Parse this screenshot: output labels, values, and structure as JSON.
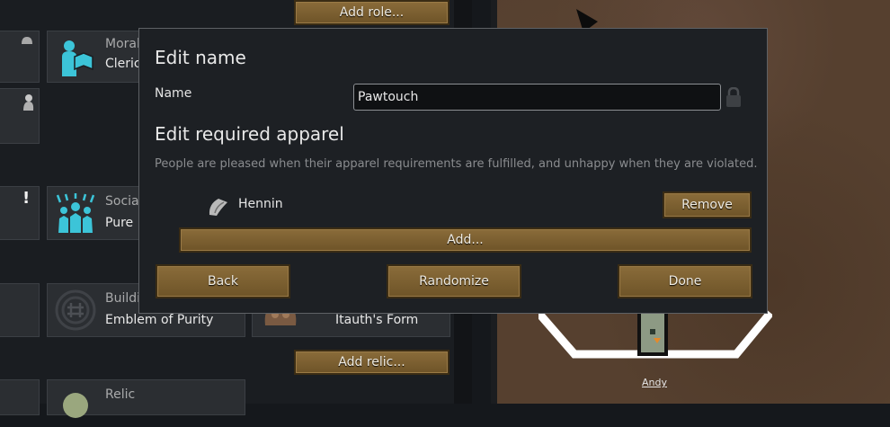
{
  "left_pane": {
    "add_role_label": "Add role...",
    "add_relic_label": "Add relic...",
    "cards": [
      {
        "category": "Moral",
        "value": "Cleric"
      },
      {
        "category": "Social",
        "value": "Pure"
      },
      {
        "category": "Building",
        "value": "Emblem of Purity"
      },
      {
        "category": "",
        "value": "Itauth's Form"
      },
      {
        "category": "Relic",
        "value": ""
      }
    ],
    "warning_glyph": "!"
  },
  "dialog": {
    "title": "Edit name",
    "name_label": "Name",
    "name_value": "Pawtouch",
    "apparel_title": "Edit required apparel",
    "apparel_desc": "People are pleased when their apparel requirements are fulfilled, and unhappy when they are violated.",
    "apparel_items": [
      {
        "name": "Hennin",
        "remove_label": "Remove"
      }
    ],
    "add_label": "Add...",
    "back_label": "Back",
    "randomize_label": "Randomize",
    "done_label": "Done"
  },
  "game": {
    "pawn_name": "Andy"
  },
  "icons": {
    "moral": "cleric-book-icon",
    "social": "pure-hands-icon",
    "building": "emblem-icon",
    "relic": "relic-icon",
    "apparel": "hennin-icon",
    "lock": "lock-icon"
  },
  "colors": {
    "button": "#7c6032",
    "dialog_bg": "#1d2024",
    "accent_icon": "#3cc4d8"
  }
}
